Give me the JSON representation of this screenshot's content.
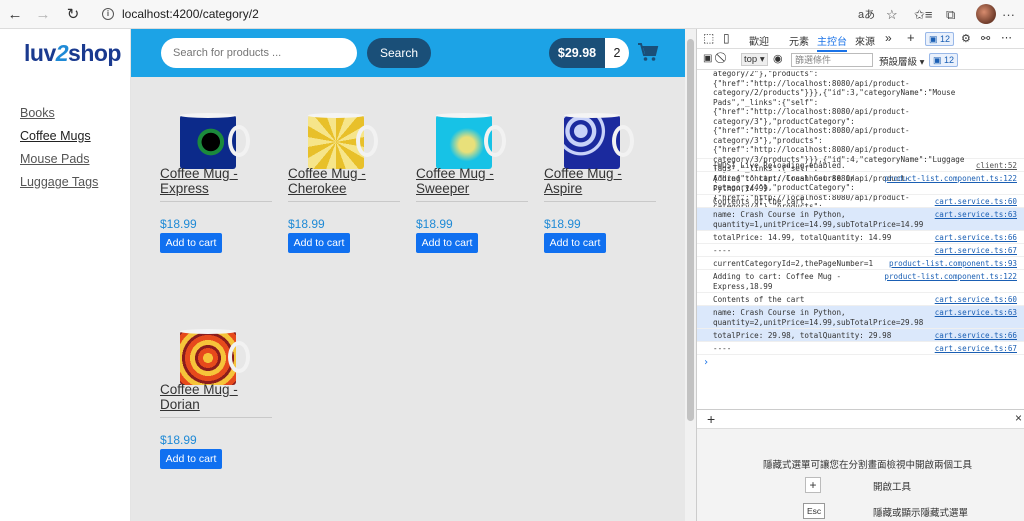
{
  "browser": {
    "url": "localhost:4200/category/2",
    "info_glyph": "i",
    "back_glyph": "←",
    "forward_glyph": "→",
    "reload_glyph": "↻",
    "read_aloud": "aあ",
    "fav_glyph": "☆",
    "favs_glyph": "✩≡",
    "collections_glyph": "⧉",
    "more_glyph": "···"
  },
  "app": {
    "logo": {
      "prefix": "luv",
      "two": "2",
      "suffix": "shop"
    },
    "search": {
      "placeholder": "Search for products ...",
      "button": "Search"
    },
    "cart": {
      "total": "$29.98",
      "quantity": "2"
    },
    "categories": [
      {
        "label": "Books"
      },
      {
        "label": "Coffee Mugs"
      },
      {
        "label": "Mouse Pads"
      },
      {
        "label": "Luggage Tags"
      }
    ],
    "products": [
      {
        "name": "Coffee Mug - Express",
        "price": "$18.99",
        "button": "Add to cart",
        "color_a": "#0c2a8a",
        "color_b": "#1b8a3c"
      },
      {
        "name": "Coffee Mug - Cherokee",
        "price": "$18.99",
        "button": "Add to cart",
        "color_a": "#e8c02a",
        "color_b": "#f6e58a"
      },
      {
        "name": "Coffee Mug - Sweeper",
        "price": "$18.99",
        "button": "Add to cart",
        "color_a": "#17c2e6",
        "color_b": "#e8e07a"
      },
      {
        "name": "Coffee Mug - Aspire",
        "price": "$18.99",
        "button": "Add to cart",
        "color_a": "#1b2a9e",
        "color_b": "#c8d2f8"
      },
      {
        "name": "Coffee Mug - Dorian",
        "price": "$18.99",
        "button": "Add to cart",
        "color_a": "#e64a1c",
        "color_b": "#f6c43a"
      }
    ]
  },
  "devtools": {
    "tabs": {
      "welcome": "歡迎",
      "elements": "元素",
      "console": "主控台",
      "sources": "來源",
      "more": "»",
      "add": "+",
      "issues": "12"
    },
    "toolbar": {
      "context": "top ▾",
      "filter_placeholder": "篩選條件",
      "levels": "預設層級 ▾",
      "issues": "12"
    },
    "console": {
      "json_lines": [
        "ategory/2\"},\"products\":{\"href\":\"http://localhost:8080/api/product-category/2/products\"}}},{\"id\":3,\"categoryName\":\"Mouse Pads\",\"_links\":{\"self\":{\"href\":\"http://localhost:8080/api/product-category/3\"},\"productCategory\":{\"href\":\"http://localhost:8080/api/product-category/3\"},\"products\":{\"href\":\"http://localhost:8080/api/product-category/3/products\"}}},{\"id\":4,\"categoryName\":\"Luggage Tags\",\"_links\":{\"self\":{\"href\":\"http://localhost:8080/api/product-category/4\"},\"productCategory\":{\"href\":\"http://localhost:8080/api/product-category/4\"},\"products\":{\"href\":\"http://localhost:8080/api/product-category/4/products\"}}}]}"
      ],
      "rows": [
        {
          "msg": "[WDS] Live Reloading enabled.",
          "src": "client:52"
        },
        {
          "msg": "Adding to cart: Crash Course in\nPython,14.99",
          "src": "product-list.component.ts:122"
        },
        {
          "msg": "Contents of the cart",
          "src": "cart.service.ts:60"
        },
        {
          "msg": "name: Crash Course in Python,\nquantity=1,unitPrice=14.99,subTotalPrice=14.99",
          "src": "cart.service.ts:63"
        },
        {
          "msg": "totalPrice: 14.99, totalQuantity: 14.99",
          "src": "cart.service.ts:66"
        },
        {
          "msg": "----",
          "src": "cart.service.ts:67"
        },
        {
          "msg": "currentCategoryId=2,thePageNumber=1",
          "src": "product-list.component.ts:93"
        },
        {
          "msg": "Adding to cart: Coffee Mug -\nExpress,18.99",
          "src": "product-list.component.ts:122"
        },
        {
          "msg": "Contents of the cart",
          "src": "cart.service.ts:60"
        },
        {
          "msg": "name: Crash Course in Python,\nquantity=2,unitPrice=14.99,subTotalPrice=29.98",
          "src": "cart.service.ts:63"
        },
        {
          "msg": "totalPrice: 29.98, totalQuantity: 29.98",
          "src": "cart.service.ts:66"
        },
        {
          "msg": "----",
          "src": "cart.service.ts:67"
        }
      ],
      "prompt": "›"
    },
    "drawer": {
      "message": "隱藏式選單可讓您在分割畫面檢視中開啟兩個工具",
      "open_tool": "開啟工具",
      "toggle_hint": "隱藏或顯示隱藏式選單",
      "plus": "+",
      "esc": "Esc",
      "close": "×"
    }
  }
}
